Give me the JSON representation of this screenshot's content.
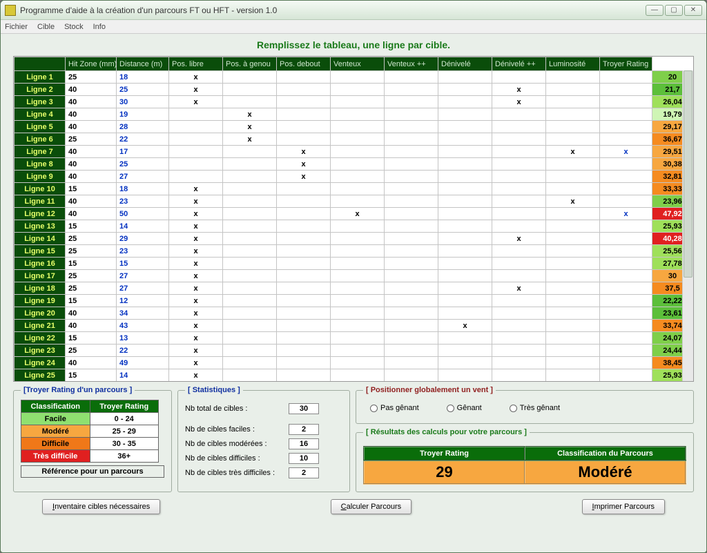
{
  "window": {
    "title": "Programme d'aide à la création d'un parcours FT ou HFT  -  version 1.0"
  },
  "menu": [
    "Fichier",
    "Cible",
    "Stock",
    "Info"
  ],
  "instruction": "Remplissez le tableau, une ligne par cible.",
  "headers": [
    "",
    "Hit Zone (mm)",
    "Distance (m)",
    "Pos. libre",
    "Pos. à genou",
    "Pos. debout",
    "Venteux",
    "Venteux ++",
    "Dénivelé",
    "Dénivelé ++",
    "Luminosité",
    "Troyer Rating"
  ],
  "rows": [
    {
      "n": "Ligne 1",
      "hit": "25",
      "dist": "18",
      "marks": [
        "x",
        "",
        "",
        "",
        "",
        "",
        "",
        "",
        ""
      ],
      "rating": "20",
      "cls": "rating-g2"
    },
    {
      "n": "Ligne 2",
      "hit": "40",
      "dist": "25",
      "marks": [
        "x",
        "",
        "",
        "",
        "",
        "",
        "x",
        "",
        ""
      ],
      "rating": "21,7",
      "cls": "rating-g1"
    },
    {
      "n": "Ligne 3",
      "hit": "40",
      "dist": "30",
      "marks": [
        "x",
        "",
        "",
        "",
        "",
        "",
        "x",
        "",
        ""
      ],
      "rating": "26,04",
      "cls": "rating-g3"
    },
    {
      "n": "Ligne 4",
      "hit": "40",
      "dist": "19",
      "marks": [
        "",
        "x",
        "",
        "",
        "",
        "",
        "",
        "",
        ""
      ],
      "rating": "19,79",
      "cls": "rating-lg"
    },
    {
      "n": "Ligne 5",
      "hit": "40",
      "dist": "28",
      "marks": [
        "",
        "x",
        "",
        "",
        "",
        "",
        "",
        "",
        ""
      ],
      "rating": "29,17",
      "cls": "rating-o1"
    },
    {
      "n": "Ligne 6",
      "hit": "25",
      "dist": "22",
      "marks": [
        "",
        "x",
        "",
        "",
        "",
        "",
        "",
        "",
        ""
      ],
      "rating": "36,67",
      "cls": "rating-o2"
    },
    {
      "n": "Ligne 7",
      "hit": "40",
      "dist": "17",
      "marks": [
        "",
        "",
        "x",
        "",
        "",
        "",
        "",
        "x",
        "x"
      ],
      "rating": "29,51",
      "cls": "rating-o1"
    },
    {
      "n": "Ligne 8",
      "hit": "40",
      "dist": "25",
      "marks": [
        "",
        "",
        "x",
        "",
        "",
        "",
        "",
        "",
        ""
      ],
      "rating": "30,38",
      "cls": "rating-o1"
    },
    {
      "n": "Ligne 9",
      "hit": "40",
      "dist": "27",
      "marks": [
        "",
        "",
        "x",
        "",
        "",
        "",
        "",
        "",
        ""
      ],
      "rating": "32,81",
      "cls": "rating-o2"
    },
    {
      "n": "Ligne 10",
      "hit": "15",
      "dist": "18",
      "marks": [
        "x",
        "",
        "",
        "",
        "",
        "",
        "",
        "",
        ""
      ],
      "rating": "33,33",
      "cls": "rating-o2"
    },
    {
      "n": "Ligne 11",
      "hit": "40",
      "dist": "23",
      "marks": [
        "x",
        "",
        "",
        "",
        "",
        "",
        "",
        "x",
        ""
      ],
      "rating": "23,96",
      "cls": "rating-g2"
    },
    {
      "n": "Ligne 12",
      "hit": "40",
      "dist": "50",
      "marks": [
        "x",
        "",
        "",
        "x",
        "",
        "",
        "",
        "",
        "x"
      ],
      "rating": "47,92",
      "cls": "rating-r"
    },
    {
      "n": "Ligne 13",
      "hit": "15",
      "dist": "14",
      "marks": [
        "x",
        "",
        "",
        "",
        "",
        "",
        "",
        "",
        ""
      ],
      "rating": "25,93",
      "cls": "rating-g3"
    },
    {
      "n": "Ligne 14",
      "hit": "25",
      "dist": "29",
      "marks": [
        "x",
        "",
        "",
        "",
        "",
        "",
        "x",
        "",
        ""
      ],
      "rating": "40,28",
      "cls": "rating-r"
    },
    {
      "n": "Ligne 15",
      "hit": "25",
      "dist": "23",
      "marks": [
        "x",
        "",
        "",
        "",
        "",
        "",
        "",
        "",
        ""
      ],
      "rating": "25,56",
      "cls": "rating-g3"
    },
    {
      "n": "Ligne 16",
      "hit": "15",
      "dist": "15",
      "marks": [
        "x",
        "",
        "",
        "",
        "",
        "",
        "",
        "",
        ""
      ],
      "rating": "27,78",
      "cls": "rating-g3"
    },
    {
      "n": "Ligne 17",
      "hit": "25",
      "dist": "27",
      "marks": [
        "x",
        "",
        "",
        "",
        "",
        "",
        "",
        "",
        ""
      ],
      "rating": "30",
      "cls": "rating-o1"
    },
    {
      "n": "Ligne 18",
      "hit": "25",
      "dist": "27",
      "marks": [
        "x",
        "",
        "",
        "",
        "",
        "",
        "x",
        "",
        ""
      ],
      "rating": "37,5",
      "cls": "rating-o2"
    },
    {
      "n": "Ligne 19",
      "hit": "15",
      "dist": "12",
      "marks": [
        "x",
        "",
        "",
        "",
        "",
        "",
        "",
        "",
        ""
      ],
      "rating": "22,22",
      "cls": "rating-g1"
    },
    {
      "n": "Ligne 20",
      "hit": "40",
      "dist": "34",
      "marks": [
        "x",
        "",
        "",
        "",
        "",
        "",
        "",
        "",
        ""
      ],
      "rating": "23,61",
      "cls": "rating-g1"
    },
    {
      "n": "Ligne 21",
      "hit": "40",
      "dist": "43",
      "marks": [
        "x",
        "",
        "",
        "",
        "",
        "x",
        "",
        "",
        ""
      ],
      "rating": "33,74",
      "cls": "rating-o2"
    },
    {
      "n": "Ligne 22",
      "hit": "15",
      "dist": "13",
      "marks": [
        "x",
        "",
        "",
        "",
        "",
        "",
        "",
        "",
        ""
      ],
      "rating": "24,07",
      "cls": "rating-g2"
    },
    {
      "n": "Ligne 23",
      "hit": "25",
      "dist": "22",
      "marks": [
        "x",
        "",
        "",
        "",
        "",
        "",
        "",
        "",
        ""
      ],
      "rating": "24,44",
      "cls": "rating-g2"
    },
    {
      "n": "Ligne 24",
      "hit": "40",
      "dist": "49",
      "marks": [
        "x",
        "",
        "",
        "",
        "",
        "",
        "",
        "",
        ""
      ],
      "rating": "38,45",
      "cls": "rating-o2"
    },
    {
      "n": "Ligne 25",
      "hit": "15",
      "dist": "14",
      "marks": [
        "x",
        "",
        "",
        "",
        "",
        "",
        "",
        "",
        ""
      ],
      "rating": "25,93",
      "cls": "rating-g3"
    }
  ],
  "classbox": {
    "legend": "[Troyer Rating d'un parcours ]",
    "headers": [
      "Classification",
      "Troyer Rating"
    ],
    "rows": [
      {
        "c": "Facile",
        "r": "0 - 24",
        "cls": "c-fac"
      },
      {
        "c": "Modéré",
        "r": "25 - 29",
        "cls": "c-mod"
      },
      {
        "c": "Difficile",
        "r": "30 - 35",
        "cls": "c-dif"
      },
      {
        "c": "Très difficile",
        "r": "36+",
        "cls": "c-tdf"
      }
    ],
    "ref": "Référence pour un parcours"
  },
  "stats": {
    "legend": "[ Statistiques ]",
    "lines": [
      {
        "lbl": "Nb total de cibles :",
        "val": "30"
      },
      {
        "lbl": "Nb de cibles faciles :",
        "val": "2"
      },
      {
        "lbl": "Nb de cibles modérées :",
        "val": "16"
      },
      {
        "lbl": "Nb de cibles difficiles :",
        "val": "10"
      },
      {
        "lbl": "Nb de cibles très difficiles :",
        "val": "2"
      }
    ]
  },
  "wind": {
    "legend": "[ Positionner globalement un vent ]",
    "options": [
      "Pas gênant",
      "Gênant",
      "Très gênant"
    ]
  },
  "results": {
    "legend": "[ Résultats des calculs pour votre parcours ]",
    "headers": [
      "Troyer Rating",
      "Classification du Parcours"
    ],
    "values": [
      "29",
      "Modéré"
    ]
  },
  "buttons": {
    "inv_pre": "I",
    "inv": "nventaire cibles nécessaires",
    "calc_pre": "C",
    "calc": "alculer Parcours",
    "print_pre": "I",
    "print": "mprimer Parcours"
  }
}
